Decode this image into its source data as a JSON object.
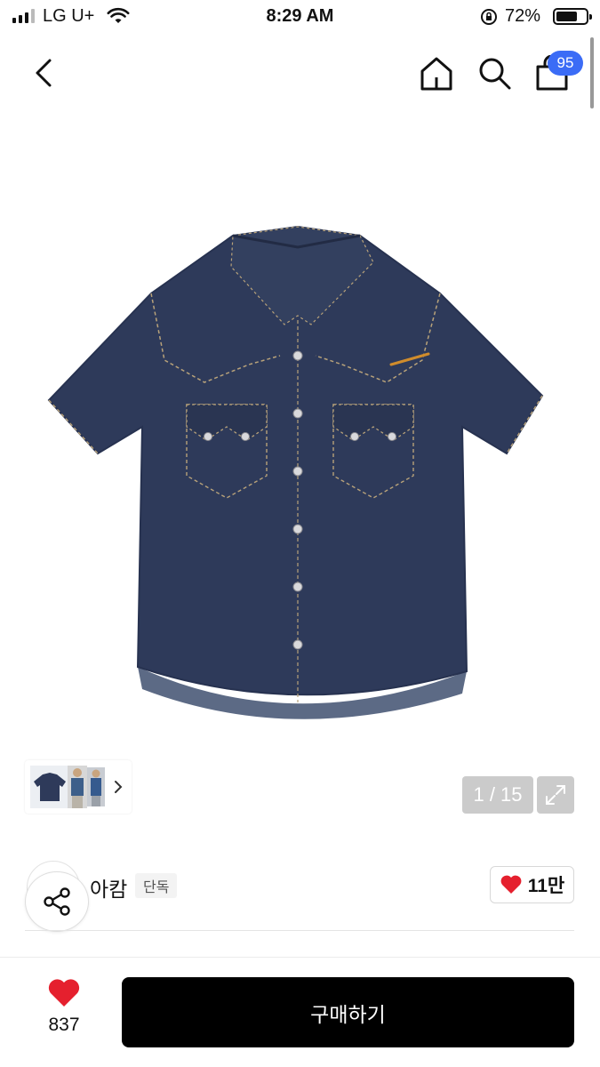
{
  "status_bar": {
    "carrier": "LG U+",
    "time": "8:29 AM",
    "battery": "72%",
    "battery_level": 0.72
  },
  "nav": {
    "icons": [
      "back-icon",
      "home-icon",
      "search-icon",
      "shopping-bag-icon"
    ],
    "cart_count": "95"
  },
  "gallery": {
    "counter": "1 / 15",
    "icons": [
      "chevron-right-icon",
      "expand-icon"
    ]
  },
  "brand": {
    "name": "아캄",
    "exclusive_tag": "단독",
    "likes": "11만",
    "icons": [
      "share-icon",
      "heart-icon"
    ]
  },
  "bottom_bar": {
    "wish_count": "837",
    "buy_label": "구매하기"
  },
  "colors": {
    "accent_blue": "#3b6cf6",
    "heart_red": "#e5202e",
    "denim": "#2e3a5a",
    "buy_button": "#000000"
  }
}
